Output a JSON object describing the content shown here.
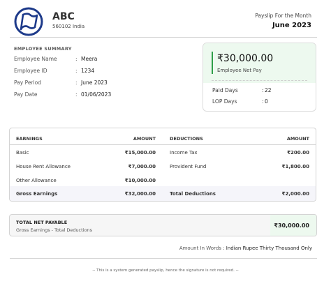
{
  "company": {
    "name": "ABC",
    "address": "560102 India",
    "logo_icon": "flag-logo-icon",
    "logo_color": "#1d3a8a"
  },
  "payslip": {
    "label": "Payslip For the Month",
    "month": "June 2023"
  },
  "summary": {
    "title": "EMPLOYEE SUMMARY",
    "rows": [
      {
        "label": "Employee Name",
        "value": "Meera"
      },
      {
        "label": "Employee ID",
        "value": "1234"
      },
      {
        "label": "Pay Period",
        "value": "June 2023"
      },
      {
        "label": "Pay Date",
        "value": "01/06/2023"
      }
    ]
  },
  "net_pay_card": {
    "amount": "₹30,000.00",
    "label": "Employee Net Pay",
    "accent_color": "#2e9e48",
    "paid_days_label": "Paid Days",
    "paid_days_value": "22",
    "lop_days_label": "LOP Days",
    "lop_days_value": "0"
  },
  "earnings_table": {
    "headers": {
      "earnings": "EARNINGS",
      "earnings_amount": "AMOUNT",
      "deductions": "DEDUCTIONS",
      "deductions_amount": "AMOUNT"
    },
    "rows": [
      {
        "earning": "Basic",
        "earning_amount": "₹15,000.00",
        "deduction": "Income Tax",
        "deduction_amount": "₹200.00"
      },
      {
        "earning": "House Rent Allowance",
        "earning_amount": "₹7,000.00",
        "deduction": "Provident Fund",
        "deduction_amount": "₹1,800.00"
      },
      {
        "earning": "Other Allowance",
        "earning_amount": "₹10,000.00",
        "deduction": "",
        "deduction_amount": ""
      }
    ],
    "totals": {
      "earnings_label": "Gross Earnings",
      "earnings_amount": "₹32,000.00",
      "deductions_label": "Total Deductions",
      "deductions_amount": "₹2,000.00"
    }
  },
  "total_net_payable": {
    "title": "TOTAL NET PAYABLE",
    "subtitle": "Gross Earnings - Total Deductions",
    "amount": "₹30,000.00"
  },
  "amount_in_words": {
    "label": "Amount In Words :",
    "value": "Indian Rupee Thirty Thousand Only"
  },
  "footer": "-- This is a system generated payslip, hence the signature is not required. --"
}
